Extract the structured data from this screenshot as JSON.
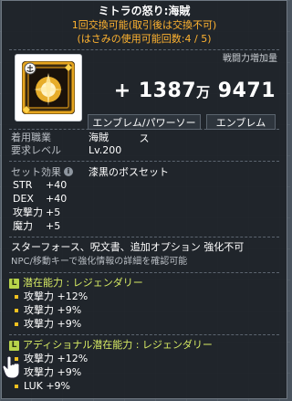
{
  "item": {
    "name": "ミトラの怒り:海賊",
    "trade_line1": "1回交換可能(取引後は交換不可)",
    "trade_line2": "(はさみの使用可能回数:4 / 5)",
    "icon": "mitra-emblem-icon"
  },
  "power": {
    "label": "戦闘力増加量",
    "sign": "+",
    "value_high": "1387",
    "unit": "万",
    "value_low": "9471"
  },
  "tags": [
    "エンブレム/パワーソース",
    "エンブレム"
  ],
  "requirements": {
    "job_label": "着用職業",
    "job_value": "海賊",
    "level_label": "要求レベル",
    "level_value": "Lv.200"
  },
  "set_effect": {
    "label": "セット効果",
    "icon": "info-icon",
    "name": "漆黒のボスセット"
  },
  "stats": [
    {
      "name": "STR",
      "value": "+40"
    },
    {
      "name": "DEX",
      "value": "+40"
    },
    {
      "name": "攻撃力",
      "value": "+5"
    },
    {
      "name": "魔力",
      "value": "+5"
    }
  ],
  "notes": {
    "enhance": "スターフォース、呪文書、追加オプション 強化不可",
    "hint": "NPC/移動キーで強化情報の詳細を確認可能"
  },
  "potential": {
    "badge": "L",
    "title": "潜在能力 : レジェンダリー",
    "lines": [
      "攻撃力 +12%",
      "攻撃力 +9%",
      "攻撃力 +9%"
    ]
  },
  "additional_potential": {
    "badge": "L",
    "title": "アディショナル潜在能力 : レジェンダリー",
    "lines": [
      "攻撃力 +12%",
      "攻撃力 +9%",
      "LUK +9%"
    ]
  },
  "colors": {
    "tradeable": "#ffb330",
    "legendary": "#b8d44a",
    "legendary_text": "#d8ec64",
    "bullet": "#f0c020"
  }
}
